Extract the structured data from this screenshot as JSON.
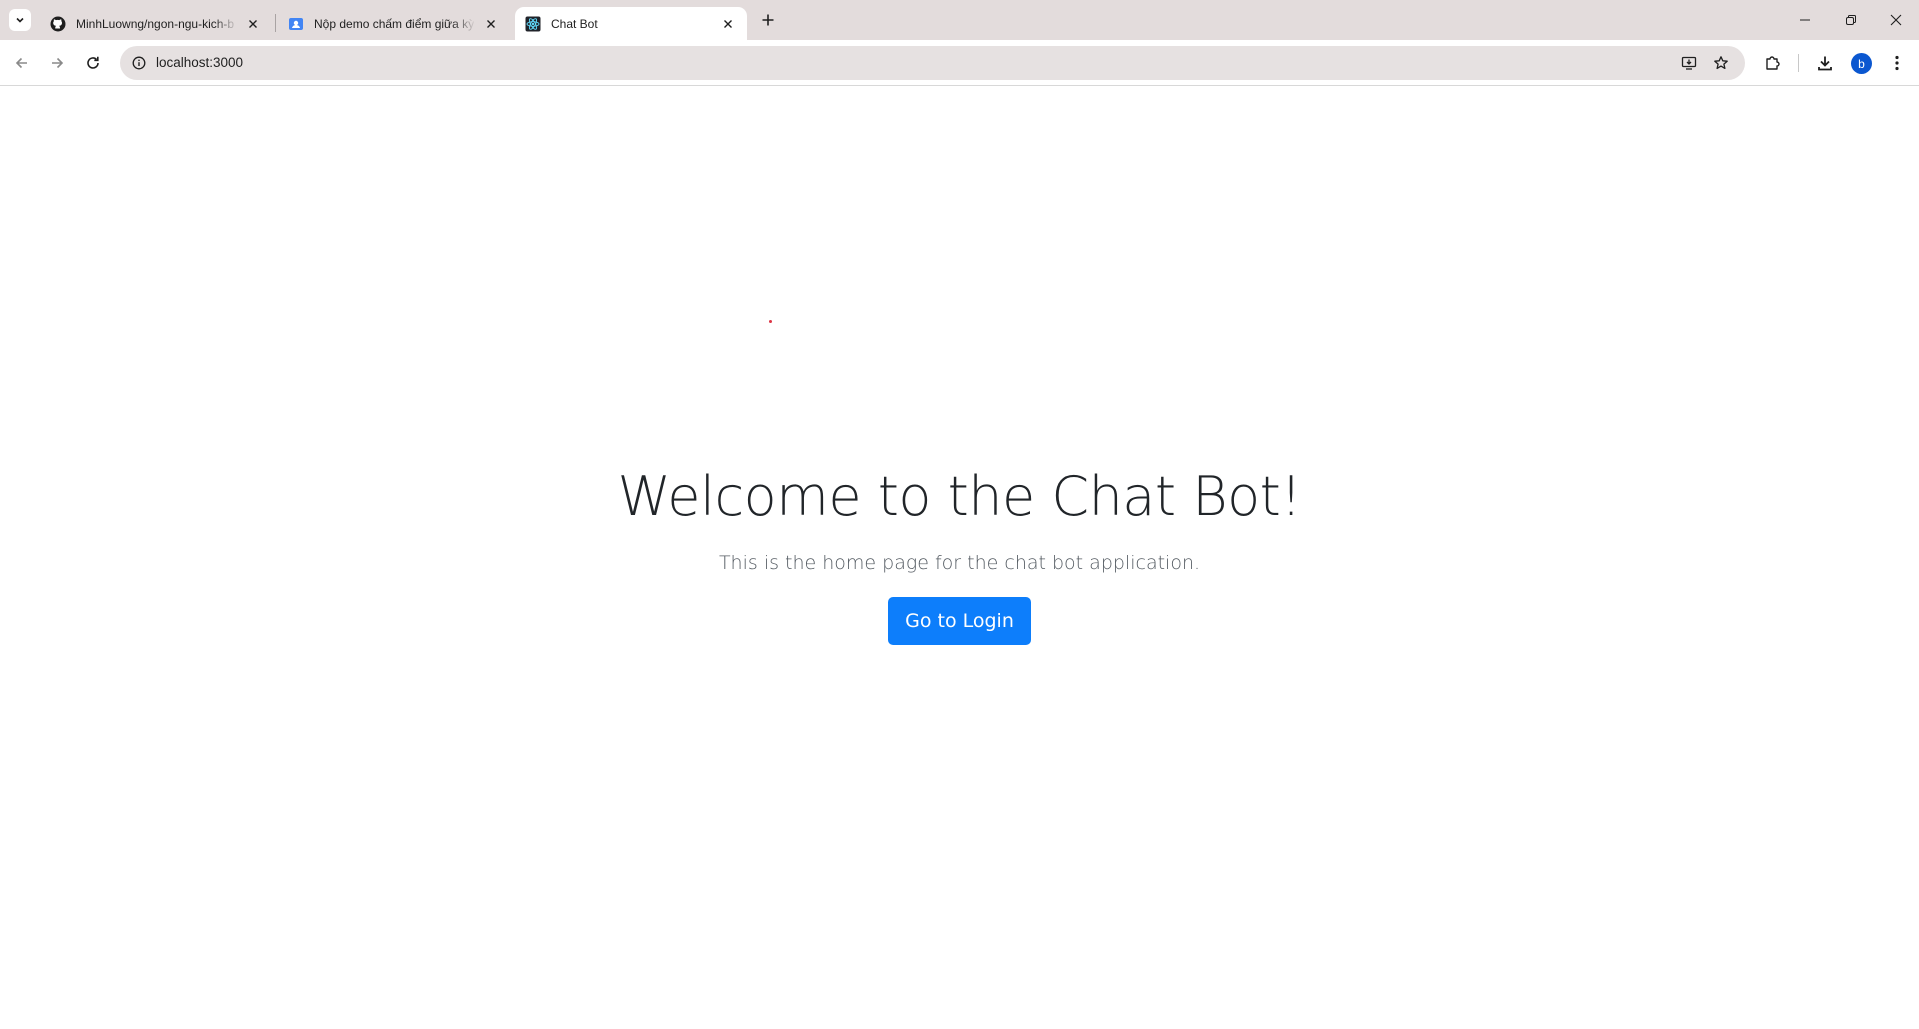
{
  "browser": {
    "tabs": [
      {
        "title": "MinhLuowng/ngon-ngu-kich-b",
        "favicon": "github-icon",
        "active": false
      },
      {
        "title": "Nộp demo chấm điểm giữa kỳ",
        "favicon": "classroom-icon",
        "active": false
      },
      {
        "title": "Chat Bot",
        "favicon": "react-icon",
        "active": true
      }
    ],
    "url": "localhost:3000",
    "profile_initial": "b",
    "accent": "#0b57d0"
  },
  "page": {
    "heading": "Welcome to the Chat Bot!",
    "lead": "This is the home page for the chat bot application.",
    "login_button": "Go to Login",
    "button_color": "#0d7efb"
  }
}
